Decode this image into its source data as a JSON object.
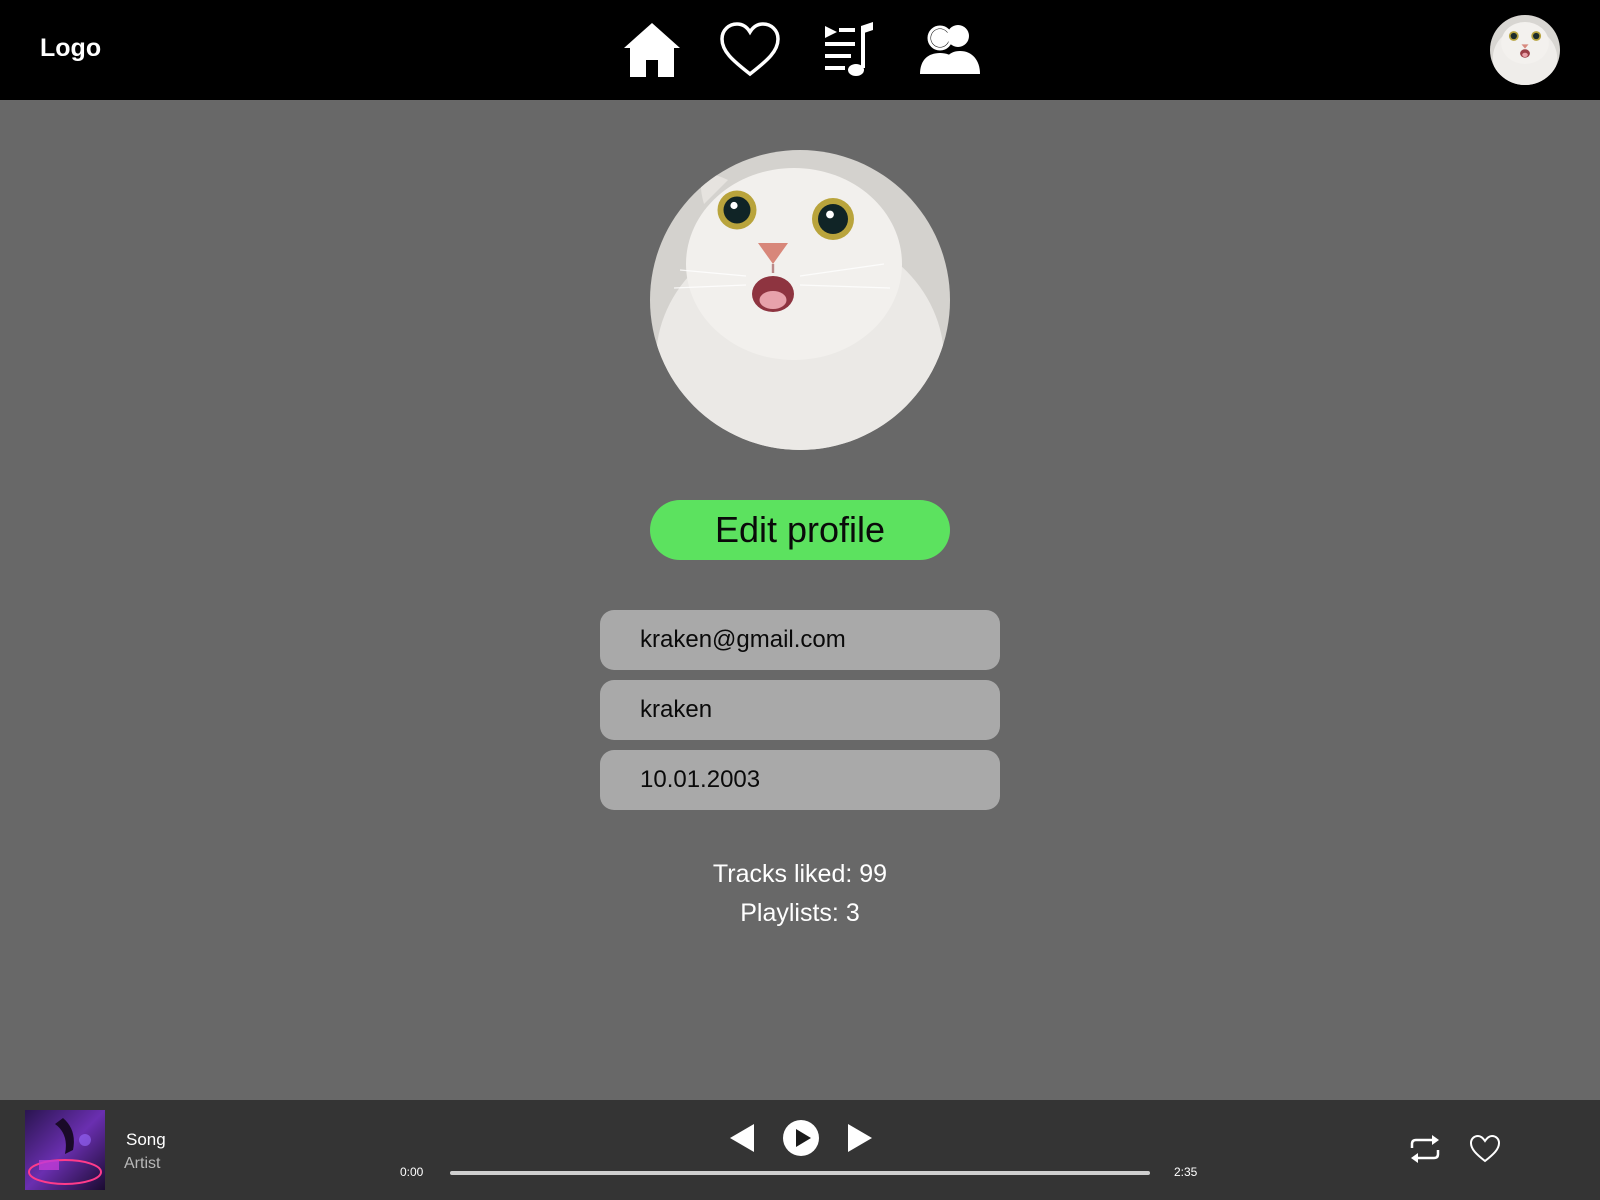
{
  "header": {
    "logo": "Logo",
    "nav": [
      {
        "name": "home-icon"
      },
      {
        "name": "heart-icon"
      },
      {
        "name": "playlist-icon"
      },
      {
        "name": "friends-icon"
      }
    ],
    "avatar_icon": "cat-avatar-icon"
  },
  "profile": {
    "avatar_icon": "cat-avatar-icon",
    "edit_label": "Edit profile",
    "email": "kraken@gmail.com",
    "username": "kraken",
    "birthdate": "10.01.2003",
    "tracks_liked": "Tracks liked: 99",
    "playlists": "Playlists: 3"
  },
  "player": {
    "song": "Song",
    "artist": "Artist",
    "time_current": "0:00",
    "time_total": "2:35",
    "progress": 0,
    "icons": [
      "prev-icon",
      "play-icon",
      "next-icon",
      "repeat-icon",
      "heart-icon"
    ]
  },
  "colors": {
    "topbar": "#000000",
    "background": "#686868",
    "accent": "#5ce25f",
    "field": "#a9a9a9",
    "player": "#343434"
  }
}
